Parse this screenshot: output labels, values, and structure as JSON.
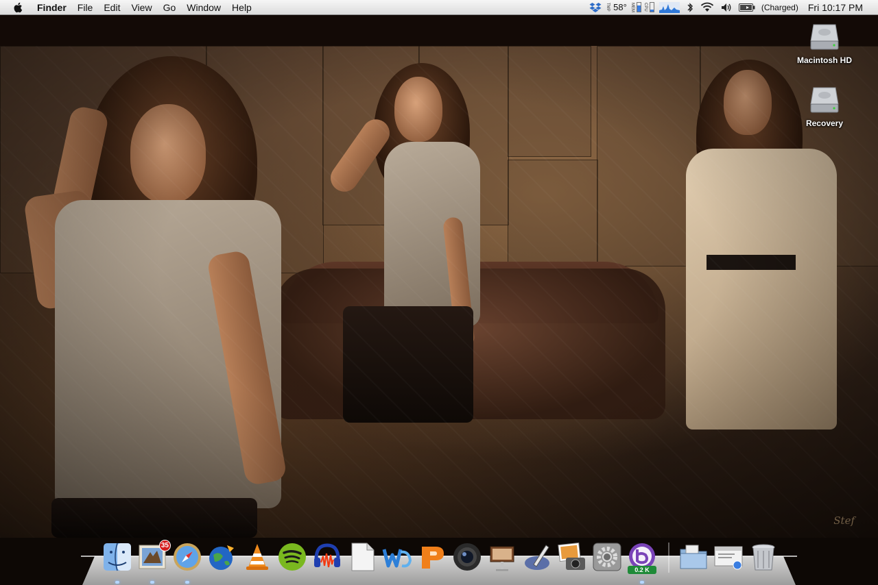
{
  "menubar": {
    "app_name": "Finder",
    "menus": [
      "File",
      "Edit",
      "View",
      "Go",
      "Window",
      "Help"
    ],
    "temperature_label": "TMP",
    "temperature": "58°",
    "mem_label": "MEM",
    "cpu_label": "CPU",
    "mem_level": 0.7,
    "cpu_level": 0.2,
    "battery_status": "(Charged)",
    "clock": "Fri 10:17 PM",
    "status_icons": [
      "dropbox-icon",
      "temperature-icon",
      "memory-meter-icon",
      "cpu-meter-icon",
      "network-graph-icon",
      "bluetooth-icon",
      "wifi-icon",
      "volume-icon",
      "battery-icon"
    ]
  },
  "desktop": {
    "icons": [
      {
        "label": "Macintosh HD",
        "icon": "hard-drive-icon"
      },
      {
        "label": "Recovery",
        "icon": "hard-drive-icon"
      }
    ],
    "signature": "Stef"
  },
  "dock": {
    "apps": [
      {
        "name": "Finder",
        "icon": "finder-icon",
        "running": true
      },
      {
        "name": "Mail",
        "icon": "mail-icon",
        "badge": "35",
        "running": true
      },
      {
        "name": "Safari",
        "icon": "safari-icon",
        "running": true
      },
      {
        "name": "Camino",
        "icon": "globe-icon",
        "running": false
      },
      {
        "name": "VLC",
        "icon": "vlc-cone-icon",
        "running": false
      },
      {
        "name": "Spotify",
        "icon": "spotify-icon",
        "running": false
      },
      {
        "name": "Audacity",
        "icon": "audacity-icon",
        "running": false
      },
      {
        "name": "TextEdit",
        "icon": "document-icon",
        "running": false
      },
      {
        "name": "Word",
        "icon": "word-icon",
        "running": false
      },
      {
        "name": "PowerPoint",
        "icon": "powerpoint-icon",
        "running": false
      },
      {
        "name": "Photo Booth",
        "icon": "camera-lens-icon",
        "running": false
      },
      {
        "name": "Keynote",
        "icon": "keynote-icon",
        "running": false
      },
      {
        "name": "Script Editor",
        "icon": "pen-tablet-icon",
        "running": false
      },
      {
        "name": "iPhoto",
        "icon": "photo-camera-icon",
        "running": false
      },
      {
        "name": "System Preferences",
        "icon": "gear-icon",
        "running": false
      },
      {
        "name": "BitTorrent",
        "icon": "bittorrent-icon",
        "download_rate": "0.2 K",
        "running": true
      }
    ],
    "stacks": [
      {
        "name": "Applications",
        "icon": "folder-icon"
      },
      {
        "name": "Downloads",
        "icon": "downloads-stack-icon"
      },
      {
        "name": "Trash",
        "icon": "trash-icon"
      }
    ]
  },
  "colors": {
    "menubar": "#e8e8e8",
    "wallpaper_tone": "#4a3424",
    "dock_shelf": "#cfcfcf",
    "badge": "#d41d1d",
    "download_label": "#1f8a38"
  }
}
